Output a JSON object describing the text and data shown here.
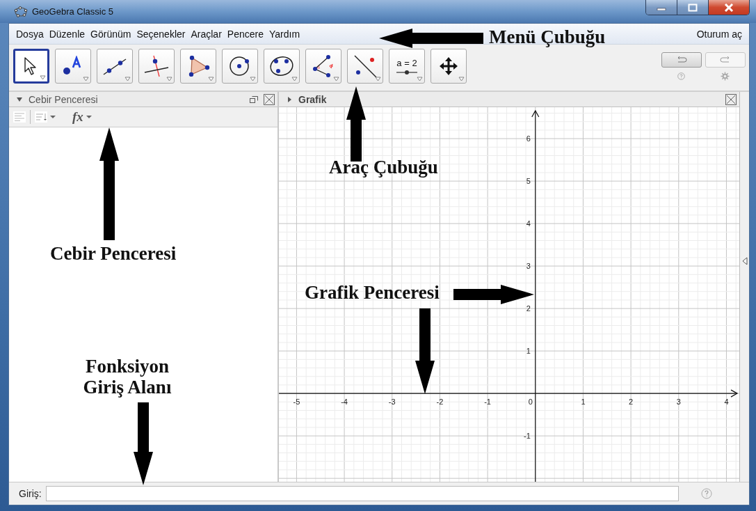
{
  "window": {
    "title": "GeoGebra Classic 5"
  },
  "menu": {
    "items": [
      "Dosya",
      "Düzenle",
      "Görünüm",
      "Seçenekler",
      "Araçlar",
      "Pencere",
      "Yardım"
    ],
    "sign_in": "Oturum aç"
  },
  "toolbar": {
    "tools": [
      {
        "kind": "move",
        "selected": true
      },
      {
        "kind": "point",
        "selected": false
      },
      {
        "kind": "line",
        "selected": false
      },
      {
        "kind": "perpendicular",
        "selected": false
      },
      {
        "kind": "polygon",
        "selected": false
      },
      {
        "kind": "circle",
        "selected": false
      },
      {
        "kind": "conic",
        "selected": false
      },
      {
        "kind": "angle",
        "selected": false
      },
      {
        "kind": "reflect",
        "selected": false
      },
      {
        "kind": "slider",
        "label": "a = 2",
        "selected": false
      },
      {
        "kind": "move_view",
        "selected": false
      }
    ]
  },
  "algebra_view": {
    "title": "Cebir Penceresi",
    "expanded": true,
    "function_button": "fx"
  },
  "graphics_view": {
    "title": "Grafik",
    "expanded": false,
    "chart_data": {
      "type": "line",
      "xlim": [
        -5.37,
        4.27
      ],
      "ylim": [
        -2.08,
        6.74
      ],
      "xticks": [
        -5,
        -4,
        -3,
        -2,
        -1,
        1,
        2,
        3,
        4
      ],
      "yticks": [
        -1,
        1,
        2,
        3,
        4,
        5,
        6
      ],
      "grid": true
    },
    "origin_label": "0"
  },
  "input_bar": {
    "label": "Giriş:"
  },
  "annotations": [
    {
      "text": "Menü Çubuğu"
    },
    {
      "text": "Araç Çubuğu"
    },
    {
      "text": "Cebir Penceresi"
    },
    {
      "text": "Grafik Penceresi"
    },
    {
      "text": "Fonksiyon Giriş Alanı"
    }
  ]
}
